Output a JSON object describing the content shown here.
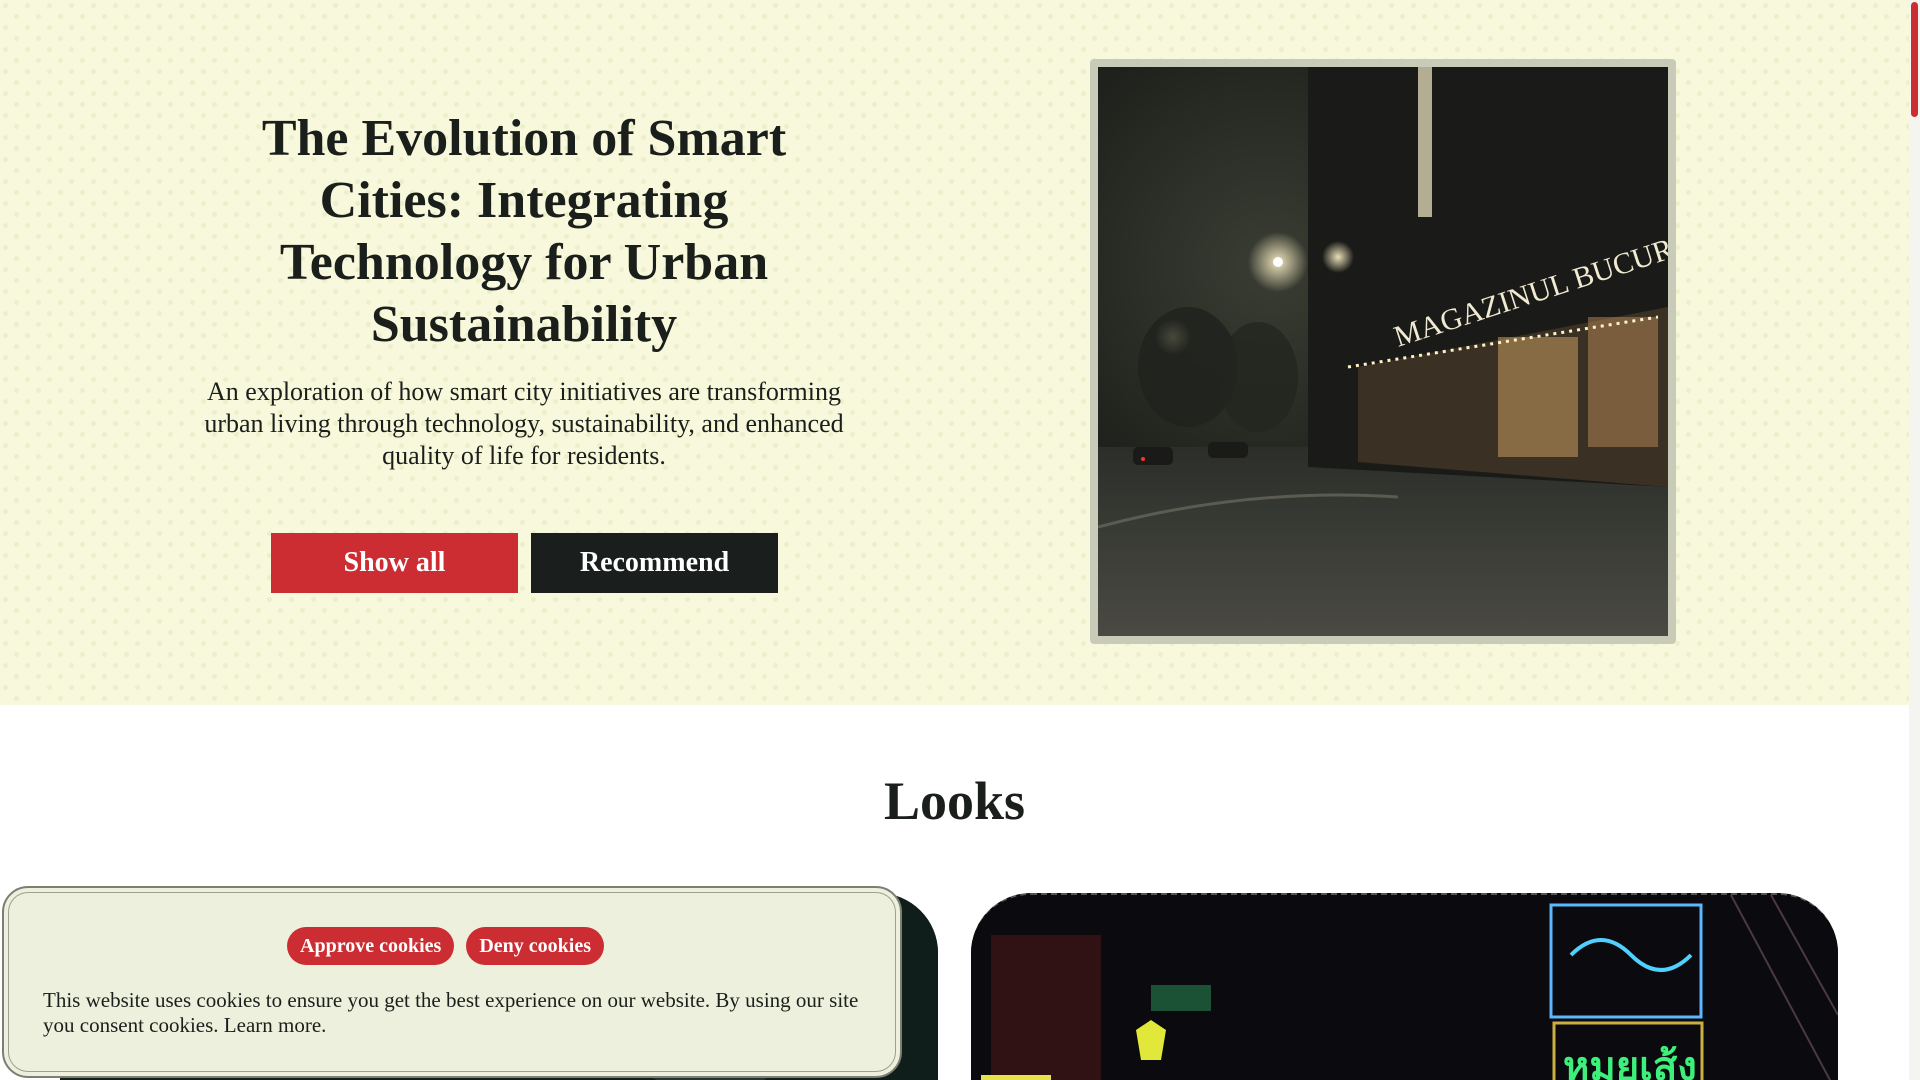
{
  "hero": {
    "title": "The Evolution of Smart Cities: Integrating Technology for Urban Sustainability",
    "subtitle": "An exploration of how smart city initiatives are transforming urban living through technology, sustainability, and enhanced quality of life for residents.",
    "primary_button": "Show all",
    "secondary_button": "Recommend",
    "photo_sign_text": "MAGAZINUL BUCURESTI"
  },
  "looks": {
    "title": "Looks",
    "neon_sign_text": "หมูยเส้ง"
  },
  "cookie_banner": {
    "approve_label": "Approve cookies",
    "deny_label": "Deny cookies",
    "message": "This website uses cookies to ensure you get the best experience on our website. By using our site you consent cookies.",
    "learn_more": "Learn more."
  },
  "colors": {
    "accent_red": "#cc2d33",
    "dark": "#1a1e1c",
    "hero_bg": "#f8f9dc",
    "cookie_bg": "#edf0dd"
  }
}
